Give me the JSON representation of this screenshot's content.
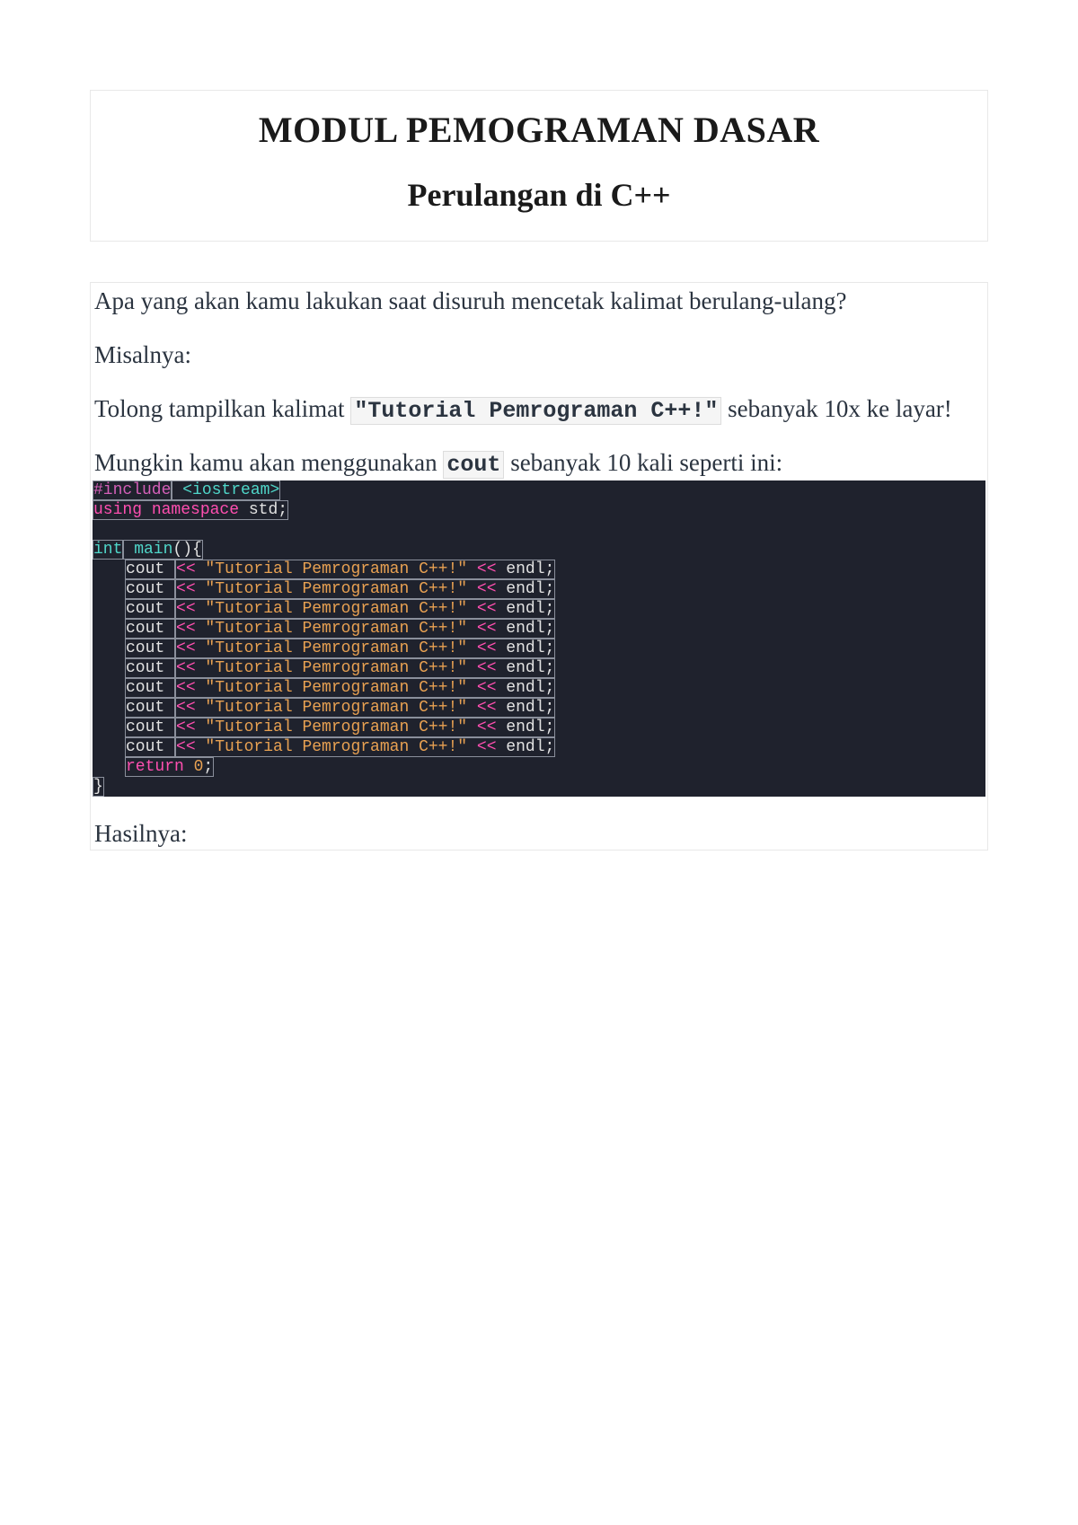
{
  "header": {
    "title": "MODUL PEMOGRAMAN DASAR",
    "subtitle": "Perulangan di C++"
  },
  "body": {
    "p1": "Apa yang akan kamu lakukan saat disuruh mencetak kalimat berulang-ulang?",
    "p2": "Misalnya:",
    "p3_a": "Tolong tampilkan kalimat ",
    "p3_code": "\"Tutorial Pemrograman C++!\"",
    "p3_b": " sebanyak 10x ke layar!",
    "p4_a": "Mungkin kamu akan menggunakan ",
    "p4_code": "cout",
    "p4_b": " sebanyak 10 kali seperti ini:",
    "after_code": "Hasilnya:"
  },
  "code": {
    "include_hash": "#include",
    "include_lib": " <iostream>",
    "using": "using",
    "namespace": " namespace",
    "std": " std",
    "semi": ";",
    "int": "int",
    "main": " main",
    "parens_brace": "(){",
    "cout": "cout ",
    "op1": "<<",
    "str": " \"Tutorial Pemrograman C++!\" ",
    "op2": "<<",
    "endl": " endl",
    "return": "return",
    "zero": " 0",
    "close_brace": "}"
  }
}
